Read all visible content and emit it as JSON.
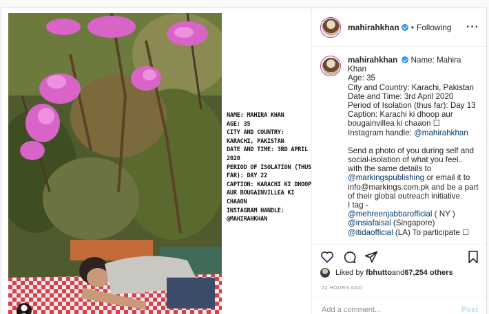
{
  "header": {
    "username": "mahirahkhan",
    "separator": "•",
    "following_label": "Following",
    "more_glyph": "···"
  },
  "image_overlay": {
    "lines": [
      "NAME: MAHIRA KHAN",
      "AGE: 35",
      "CITY AND COUNTRY: KARACHI, PAKISTAN",
      "DATE AND TIME: 3RD APRIL 2020",
      "PERIOD OF ISOLATION (THUS FAR): DAY 22",
      "CAPTION: KARACHI KI DHOOP AUR BOUGAINVILLEA KI CHAAON",
      "INSTAGRAM HANDLE: @MAHIRAHKHAN"
    ]
  },
  "caption": {
    "username": "mahirahkhan",
    "line1": "Name: Mahira Khan",
    "line2": "Age: 35",
    "line3": "City and Country: Karachi, Pakistan",
    "line4": "Date and Time: 3rd April 2020",
    "line5": "Period of Isolation (thus far): Day 13",
    "line6": "Caption: Karachi ki dhoop aur bougainvillea ki chaaon ☐",
    "line7_prefix": "Instagram handle: ",
    "line7_handle": "@mahirahkhan",
    "para2_a": "Send a photo of you during self and social-isolation of what you feel.. with the same details to",
    "para2_link1": "@markingspublishing",
    "para2_b": " or email it to info@markings.com.pk and be a part of their global outreach initiative.",
    "tag_label": "I tag -",
    "tag1": "@mehreenjabbarofficial",
    "tag1_suffix": " ( NY )",
    "tag2": "@insiafaisal",
    "tag2_suffix": " (Singapore)",
    "tag3": "@itidaofficial",
    "tag3_suffix": " (LA) To participate ☐"
  },
  "likes": {
    "prefix": "Liked by ",
    "user": "fbhutto",
    "middle": " and ",
    "count": "67,254 others"
  },
  "timestamp": "22 HOURS AGO",
  "comment": {
    "placeholder": "Add a comment...",
    "post_label": "Post"
  },
  "icons": {
    "heart": "heart-icon",
    "comment": "comment-icon",
    "share": "share-icon",
    "save": "bookmark-icon",
    "user_tag": "user-tag-icon"
  },
  "colors": {
    "link": "#00376b",
    "verified": "#3897f0",
    "post_button": "#b2dffc",
    "story_ring": "#c13584"
  }
}
